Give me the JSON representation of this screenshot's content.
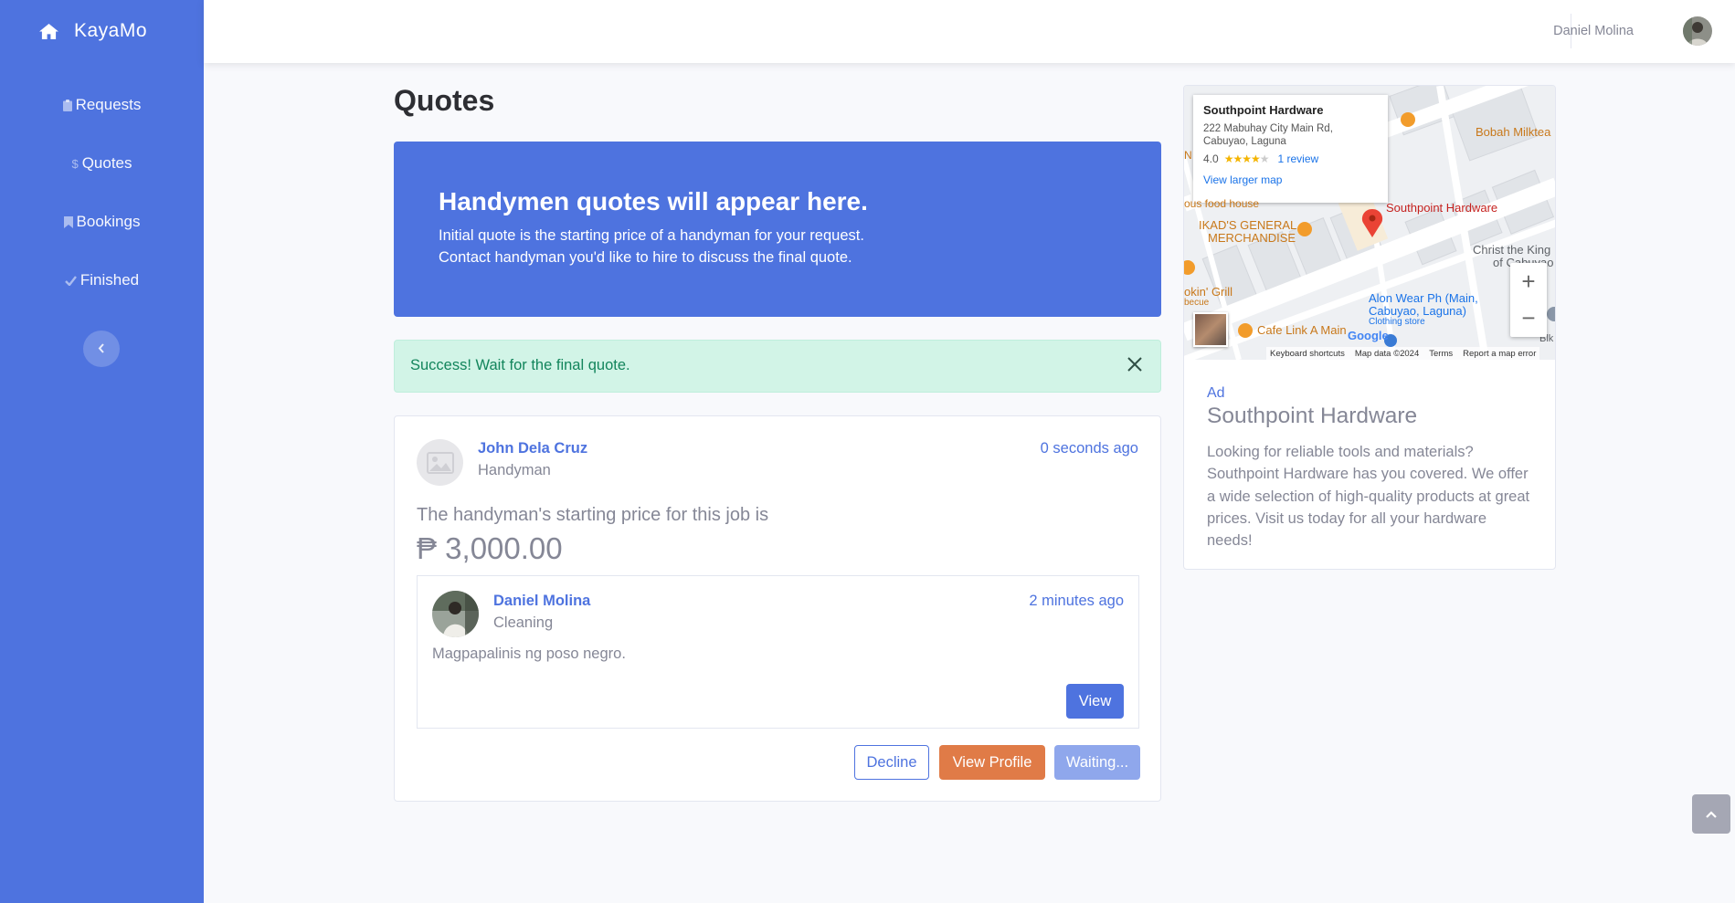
{
  "brand": {
    "name": "KayaMo",
    "icon": "home-icon"
  },
  "sidebar": {
    "items": [
      {
        "label": "Requests",
        "icon": "clipboard-icon"
      },
      {
        "label": "Quotes",
        "icon": "dollar-icon"
      },
      {
        "label": "Bookings",
        "icon": "bookmark-icon"
      },
      {
        "label": "Finished",
        "icon": "check-icon"
      }
    ],
    "toggle_icon": "chevron-left-icon"
  },
  "topbar": {
    "user_name": "Daniel Molina"
  },
  "page": {
    "title": "Quotes"
  },
  "hero": {
    "heading": "Handymen quotes will appear here.",
    "line1": "Initial quote is the starting price of a handyman for your request.",
    "line2": "Contact handyman you'd like to hire to discuss the final quote."
  },
  "alert": {
    "message": "Success! Wait for the final quote."
  },
  "quote": {
    "handyman_name": "John Dela Cruz",
    "handyman_role": "Handyman",
    "time": "0 seconds ago",
    "prompt": "The handyman's starting price for this job is",
    "price": "₱ 3,000.00",
    "request": {
      "name": "Daniel Molina",
      "category": "Cleaning",
      "time": "2 minutes ago",
      "description": "Magpapalinis ng poso negro.",
      "view_label": "View"
    },
    "decline_label": "Decline",
    "profile_label": "View Profile",
    "waiting_label": "Waiting..."
  },
  "map": {
    "place_name": "Southpoint Hardware",
    "address": "222 Mabuhay City Main Rd, Cabuyao, Laguna",
    "rating": "4.0",
    "reviews": "1 review",
    "larger_map": "View larger map",
    "labels": {
      "marker": "Southpoint Hardware",
      "bobah": "Bobah Milktea",
      "ikad1": "IKAD'S GENERAL",
      "ikad2": "MERCHANDISE",
      "christ1": "Christ the King",
      "christ2": "of Cabuyao",
      "grill1": "okin' Grill",
      "grill2": "becue",
      "alon1": "Alon Wear Ph (Main,",
      "alon2": "Cabuyao, Laguna)",
      "alon3": "Clothing store",
      "cafe": "Cafe Link A Main",
      "food": "ous food house",
      "blk": "Blk",
      "n": "N"
    },
    "zoom_in": "+",
    "zoom_out": "−",
    "google": "Google",
    "footer": {
      "shortcuts": "Keyboard shortcuts",
      "data": "Map data ©2024",
      "terms": "Terms",
      "report": "Report a map error"
    }
  },
  "ad": {
    "label": "Ad",
    "title": "Southpoint Hardware",
    "body": "Looking for reliable tools and materials? Southpoint Hardware has you covered. We offer a wide selection of high-quality products at great prices. Visit us today for all your hardware needs!"
  },
  "colors": {
    "primary": "#4e73df",
    "orange": "#e07b47",
    "success_bg": "#d2f4e7",
    "success_text": "#13855c"
  }
}
